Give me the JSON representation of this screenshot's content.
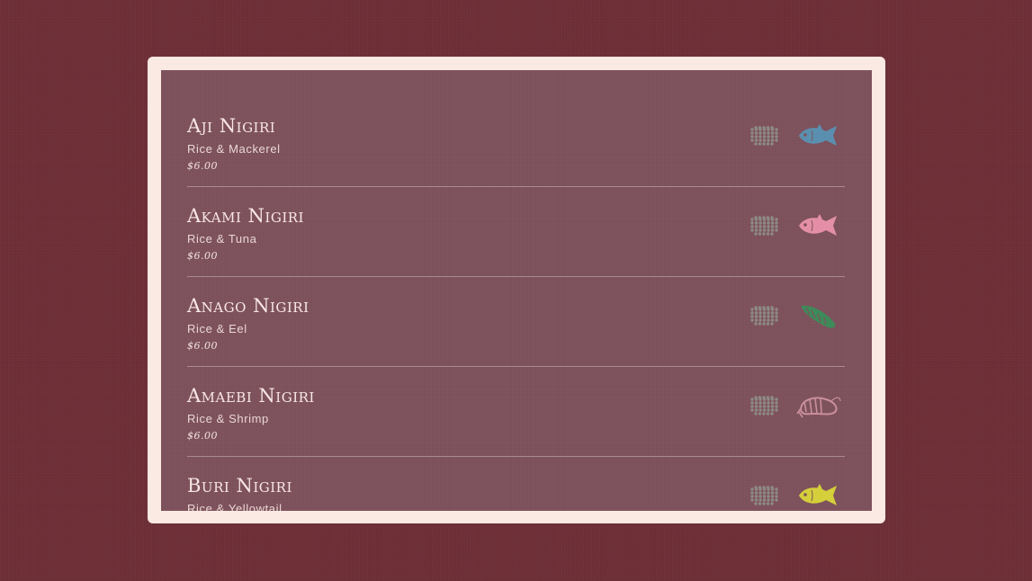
{
  "menu": {
    "items": [
      {
        "name": "Aji Nigiri",
        "description": "Rice & Mackerel",
        "price": "$6.00",
        "rice_icon": "rice-icon",
        "topping_icon": "fish-icon",
        "topping_color": "#5b8fb0"
      },
      {
        "name": "Akami Nigiri",
        "description": "Rice & Tuna",
        "price": "$6.00",
        "rice_icon": "rice-icon",
        "topping_icon": "fish-icon",
        "topping_color": "#e48fa7"
      },
      {
        "name": "Anago Nigiri",
        "description": "Rice & Eel",
        "price": "$6.00",
        "rice_icon": "rice-icon",
        "topping_icon": "eel-icon",
        "topping_color": "#3f8a5a"
      },
      {
        "name": "Amaebi Nigiri",
        "description": "Rice & Shrimp",
        "price": "$6.00",
        "rice_icon": "rice-icon",
        "topping_icon": "shrimp-icon",
        "topping_color": "#c98f9c"
      },
      {
        "name": "Buri Nigiri",
        "description": "Rice & Yellowtail",
        "price": "",
        "rice_icon": "rice-icon",
        "topping_icon": "fish-icon",
        "topping_color": "#d4cf3a"
      }
    ]
  },
  "colors": {
    "background": "#6e2f37",
    "frame": "#fbe9e3",
    "panel": "#7e525c",
    "rice": "#8e8a86"
  }
}
